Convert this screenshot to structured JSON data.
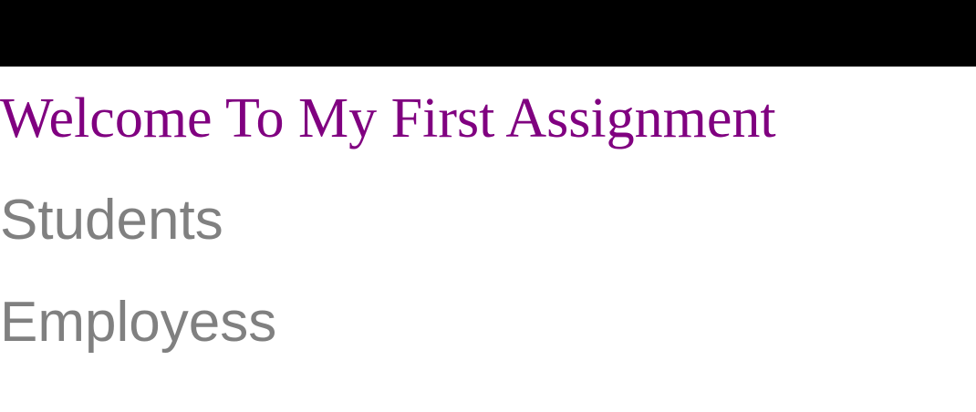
{
  "header": {
    "title": "Welcome To My First Assignment"
  },
  "nav": {
    "items": [
      {
        "label": "Students"
      },
      {
        "label": "Employess"
      }
    ]
  },
  "colors": {
    "top_bar": "#000000",
    "title": "#800080",
    "link": "#808080",
    "background": "#ffffff"
  }
}
